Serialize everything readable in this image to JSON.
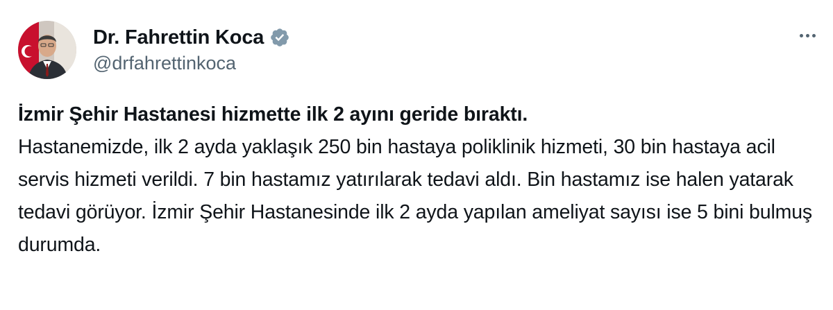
{
  "author": {
    "display_name": "Dr. Fahrettin Koca",
    "handle": "@drfahrettinkoca",
    "verified": true,
    "verified_badge_color": "#829aab"
  },
  "menu": {
    "icon": "more-horizontal-icon"
  },
  "post": {
    "headline": "İzmir Şehir Hastanesi hizmette ilk 2 ayını geride bıraktı.",
    "body": "Hastanemizde, ilk 2 ayda yaklaşık 250 bin hastaya poliklinik hizmeti, 30 bin hastaya acil servis hizmeti verildi. 7 bin hastamız yatırılarak tedavi aldı. Bin hastamız ise halen yatarak tedavi görüyor. İzmir Şehir Hastanesinde ilk 2 ayda yapılan ameliyat sayısı ise 5 bini bulmuş durumda."
  },
  "colors": {
    "text_primary": "#0f1419",
    "text_secondary": "#536471",
    "background": "#ffffff"
  }
}
